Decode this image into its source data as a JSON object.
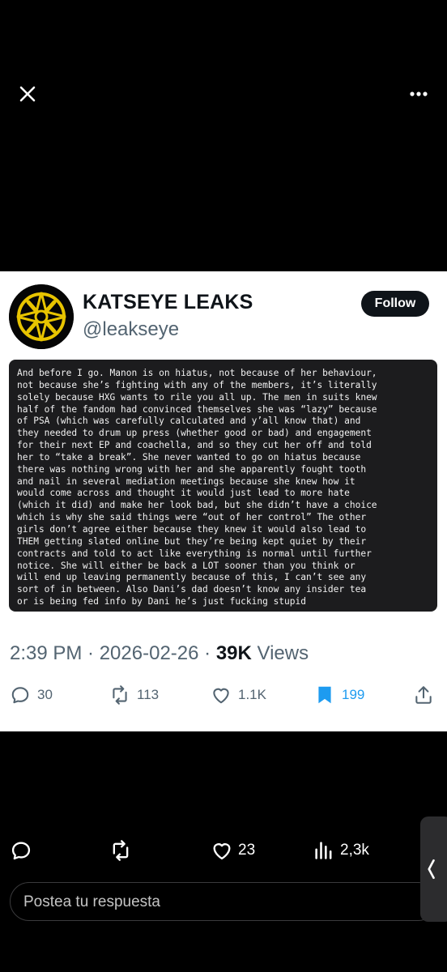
{
  "profile": {
    "display_name": "KATSEYE LEAKS",
    "handle": "@leakseye",
    "follow_label": "Follow"
  },
  "note": {
    "lines": [
      "And before I go. Manon is on hiatus, not because of her behaviour,",
      "not because she’s fighting with any of the members, it’s literally",
      "solely because HXG wants to rile you all up. The men in suits knew",
      "half of the fandom had convinced themselves she was “lazy” because",
      "of PSA (which was carefully calculated and y’all know that) and",
      "they needed to drum up press (whether good or bad) and engagement",
      "for their next EP and coachella, and so they cut her off and told",
      "her to “take a break”. She never wanted to go on hiatus because",
      "there was nothing wrong with her and she apparently fought tooth",
      "and nail in several mediation meetings because she knew how it",
      "would come across and thought it would just lead to more hate",
      "(which it did) and make her look bad, but she didn’t have a choice",
      "which is why she said things were “out of her control” The other",
      "girls don’t agree either because they knew it would also lead to",
      "THEM getting slated online but they’re being kept quiet by their",
      "contracts and told to act like everything is normal until further",
      "notice. She will either be back a LOT sooner than you think or",
      "will end up leaving permanently because of this, I can’t see any",
      "sort of in between. Also Dani’s dad doesn’t know any insider tea",
      "or is being fed info by Dani he’s just fucking stupid"
    ]
  },
  "meta": {
    "time_date": "2:39 PM · 2026-02-26 · ",
    "views_count": "39K",
    "views_label": " Views"
  },
  "actions": {
    "replies": "30",
    "reposts": "113",
    "likes": "1.1K",
    "bookmarks": "199",
    "bookmark_color": "#1d9bf0"
  },
  "bottom_bar": {
    "reposts_icon": "repost-icon",
    "likes": "23",
    "views": "2,3k"
  },
  "reply": {
    "placeholder": "Postea tu respuesta"
  }
}
